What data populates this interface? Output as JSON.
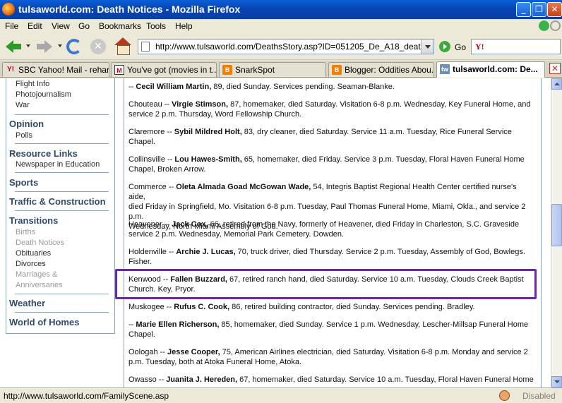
{
  "window": {
    "title": "tulsaworld.com: Death Notices - Mozilla Firefox"
  },
  "menu": [
    "File",
    "Edit",
    "View",
    "Go",
    "Bookmarks",
    "Tools",
    "Help"
  ],
  "toolbar": {
    "url": "http://www.tulsaworld.com/DeathsStory.asp?ID=051205_De_A18_death",
    "go_label": "Go",
    "search_engine": "Y!"
  },
  "tabs": [
    {
      "icon": "Y!",
      "label": "SBC Yahoo! Mail - rehar..."
    },
    {
      "icon": "M",
      "label": "You've got (movies in t..."
    },
    {
      "icon": "B",
      "label": "SnarkSpot"
    },
    {
      "icon": "B",
      "label": "Blogger: Oddities Abou..."
    },
    {
      "icon": "tw",
      "label": "tulsaworld.com: De..."
    }
  ],
  "sidebar": {
    "top_links": [
      "Flight Info",
      "Photojournalism",
      "War"
    ],
    "opinion": {
      "heading": "Opinion",
      "links": [
        "Polls"
      ]
    },
    "resource": {
      "heading": "Resource Links",
      "links": [
        "Newspaper in Education"
      ]
    },
    "sports": "Sports",
    "traffic": "Traffic & Construction",
    "transitions": {
      "heading": "Transitions",
      "links": [
        "Births",
        "Death Notices",
        "Obituaries",
        "Divorces",
        "Marriages &",
        "Anniversaries"
      ]
    },
    "weather": "Weather",
    "homes": "World of Homes"
  },
  "notices": [
    {
      "pre": "-- ",
      "name": "Cecil William Martin,",
      "rest1": " 89, died Sunday. Services pending. Seaman-Blanke.",
      "line2": ""
    },
    {
      "pre": "Chouteau -- ",
      "name": "Virgie Stimson,",
      "rest1": " 87, homemaker, died Saturday. Visitation 6-8 p.m. Wednesday, Key Funeral Home, and",
      "line2": "service 2 p.m. Thursday, Word Fellowship Church."
    },
    {
      "pre": "Claremore -- ",
      "name": "Sybil Mildred Holt,",
      "rest1": " 83, dry cleaner, died Saturday. Service 11 a.m. Tuesday, Rice Funeral Service",
      "line2": "Chapel."
    },
    {
      "pre": "Collinsville -- ",
      "name": "Lou Hawes-Smith,",
      "rest1": " 65, homemaker, died Friday. Service 3 p.m. Tuesday, Floral Haven Funeral Home",
      "line2": "Chapel, Broken Arrow."
    },
    {
      "pre": "Commerce -- ",
      "name": "Oleta Almada Goad McGowan Wade,",
      "rest1": " 54, Integris Baptist Regional Health Center certified nurse's aide,",
      "line2": "died Friday in Springfield, Mo. Visitation 6-8 p.m. Tuesday, Paul Thomas Funeral Home, Miami, Okla., and service 2 p.m.",
      "line3": "Wednesday, North Miami Assembly of God."
    },
    {
      "pre": "Heavener -- ",
      "name": "Jack Cox,",
      "rest1": " 66, retired from the Navy, formerly of Heavener, died Friday in Charleston, S.C. Graveside",
      "line2": "service 2 p.m. Wednesday, Memorial Park Cemetery. Dowden."
    },
    {
      "pre": "Holdenville -- ",
      "name": "Archie J. Lucas,",
      "rest1": " 70, truck driver, died Thursday. Service 2 p.m. Tuesday, Assembly of God, Bowlegs.",
      "line2": "Fisher."
    },
    {
      "pre": "Kenwood -- ",
      "name": "Fallen Buzzard,",
      "rest1": " 67, retired ranch hand, died Saturday. Service 10 a.m. Tuesday, Clouds Creek Baptist",
      "line2": "Church. Key, Pryor."
    },
    {
      "pre": "Muskogee -- ",
      "name": "Rufus C. Cook,",
      "rest1": " 86, retired building contractor, died Sunday. Services pending. Bradley.",
      "line2": ""
    },
    {
      "pre": "-- ",
      "name": "Marie Ellen Richerson,",
      "rest1": " 85, homemaker, died Sunday. Service 1 p.m. Wednesday, Lescher-Millsap Funeral Home",
      "line2": "Chapel."
    },
    {
      "pre": "Oologah -- ",
      "name": "Jesse Cooper,",
      "rest1": " 75, American Airlines electrician, died Saturday. Visitation 6-8 p.m. Monday and service 2",
      "line2": "p.m. Tuesday, both at Atoka Funeral Home, Atoka."
    },
    {
      "pre": "Owasso -- ",
      "name": "Juanita J. Hereden,",
      "rest1": " 67, homemaker, died Saturday. Service 10 a.m. Tuesday, Floral Haven Funeral Home",
      "line2": ""
    }
  ],
  "status": {
    "text": "http://www.tulsaworld.com/FamilyScene.asp",
    "right": "Disabled"
  }
}
